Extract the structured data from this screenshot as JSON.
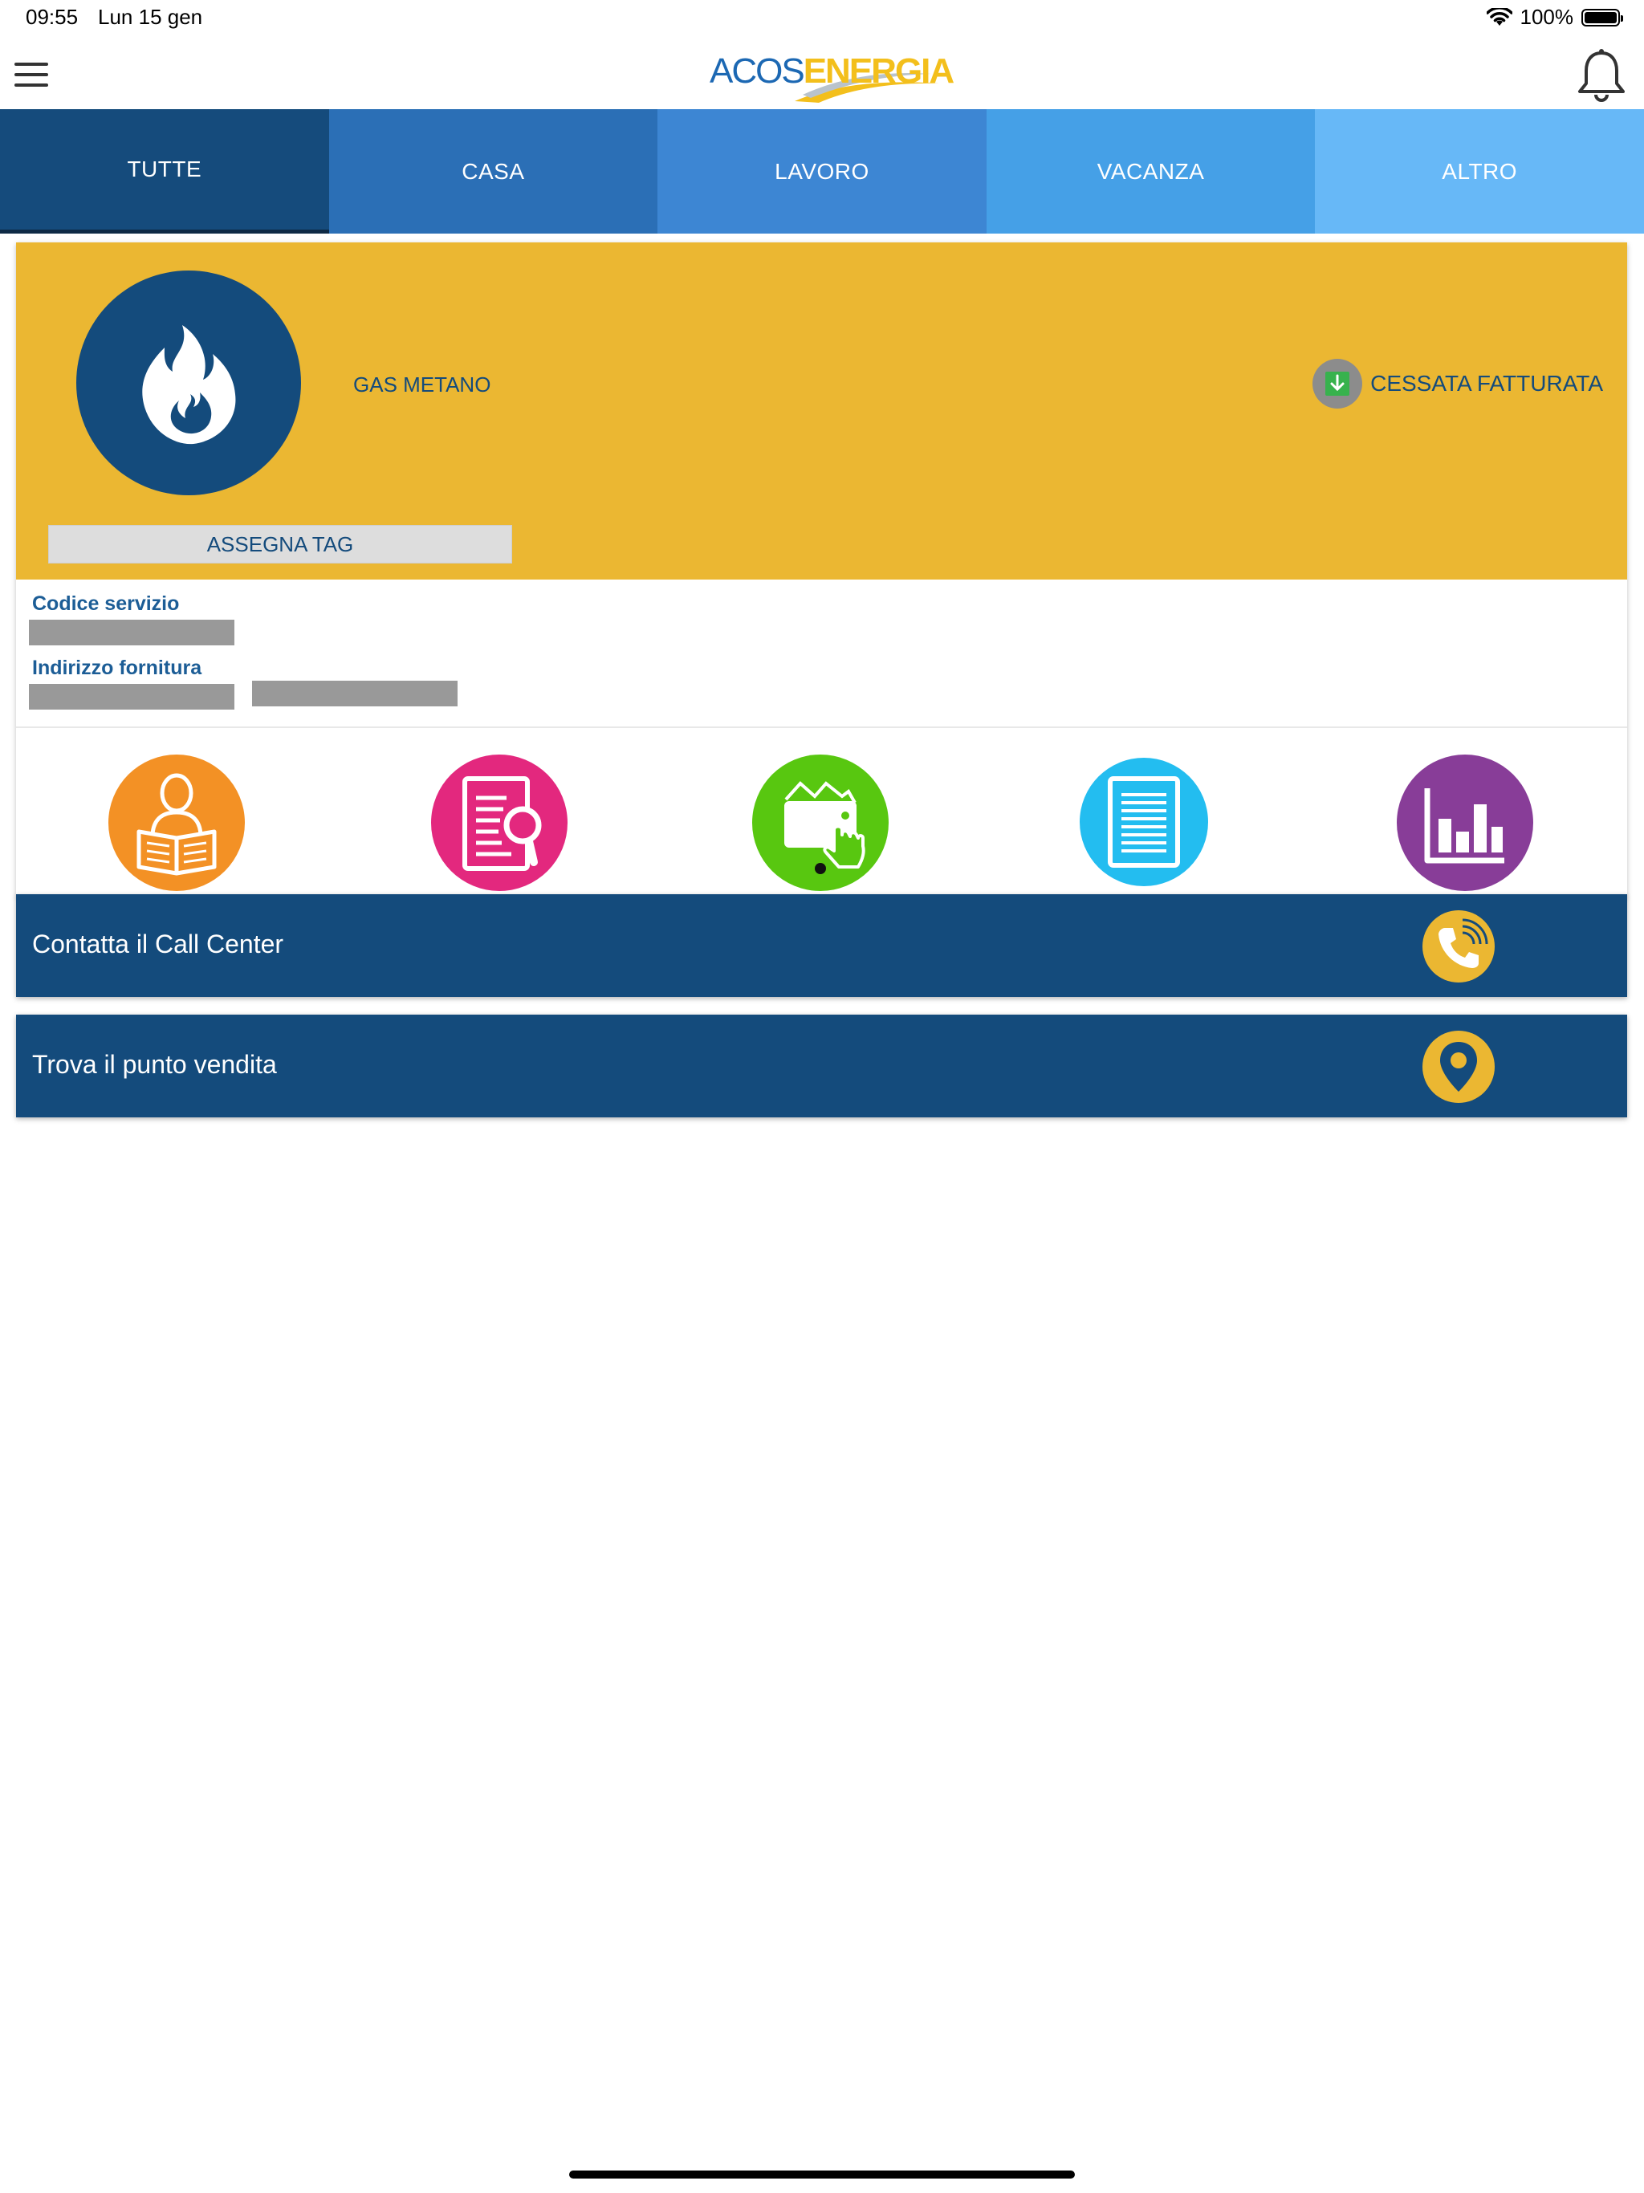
{
  "status_bar": {
    "time": "09:55",
    "date": "Lun 15 gen",
    "battery": "100%",
    "battery_level": 1.0
  },
  "header": {
    "logo_part1": "ACOS",
    "logo_part2": "ENERGIA"
  },
  "tabs": [
    {
      "label": "TUTTE",
      "color": "#154b7c",
      "active": true
    },
    {
      "label": "CASA",
      "color": "#2b6fb6"
    },
    {
      "label": "LAVORO",
      "color": "#3d86d3"
    },
    {
      "label": "VACANZA",
      "color": "#45a0e7"
    },
    {
      "label": "ALTRO",
      "color": "#67b8f7"
    }
  ],
  "service": {
    "name": "GAS METANO",
    "status": "CESSATA FATTURATA",
    "assign_tag": "ASSEGNA TAG",
    "code_label": "Codice servizio",
    "address_label": "Indirizzo fornitura"
  },
  "actions": [
    {
      "icon": "customer-reading-icon",
      "color": "#f39125"
    },
    {
      "icon": "invoice-search-icon",
      "color": "#e3287e"
    },
    {
      "icon": "wallet-payment-icon",
      "color": "#58c710"
    },
    {
      "icon": "document-icon",
      "color": "#23bdf0"
    },
    {
      "icon": "bar-chart-icon",
      "color": "#883d98"
    }
  ],
  "call_center": {
    "label": "Contatta il Call Center",
    "icon": "phone-icon"
  },
  "store": {
    "label": "Trova il punto vendita",
    "icon": "location-pin-icon"
  },
  "colors": {
    "primary": "#144b7c",
    "accent": "#ebb732"
  }
}
